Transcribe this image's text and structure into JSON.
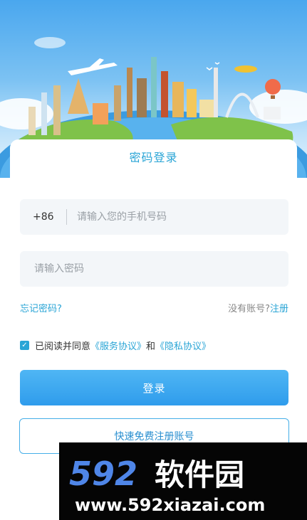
{
  "card": {
    "title": "密码登录"
  },
  "phone": {
    "country_code": "+86",
    "placeholder": "请输入您的手机号码"
  },
  "password": {
    "placeholder": "请输入密码"
  },
  "links": {
    "forgot": "忘记密码?",
    "no_account": "没有账号?",
    "register": "注册"
  },
  "agreement": {
    "checked": true,
    "prefix": "已阅读并同意",
    "service": "《服务协议》",
    "and": "和",
    "privacy": "《隐私协议》"
  },
  "buttons": {
    "login": "登录",
    "quick_register": "快速免费注册账号"
  },
  "watermark": {
    "brand": "592软件园",
    "url": "www.592xiazai.com"
  },
  "colors": {
    "accent": "#2aa5d6",
    "button": "#3aa8f0"
  }
}
